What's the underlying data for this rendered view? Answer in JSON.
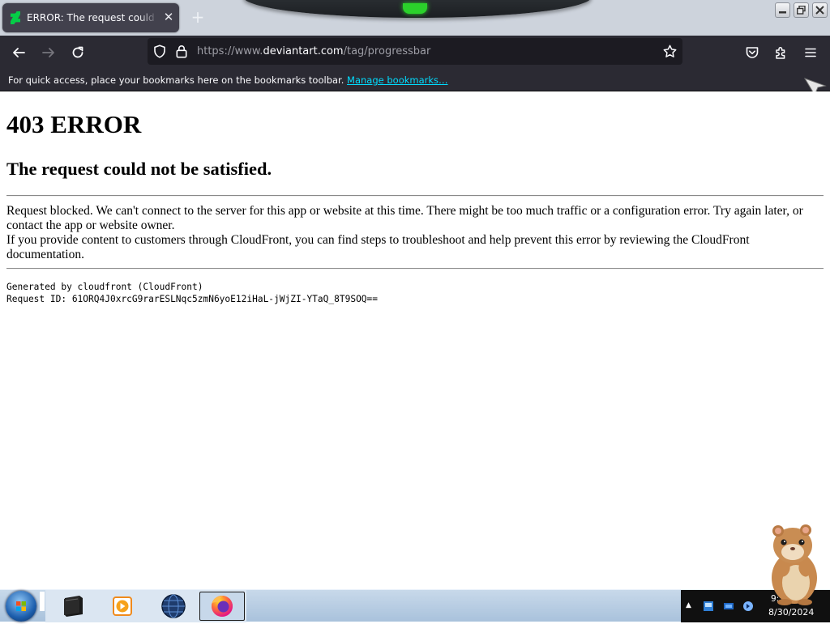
{
  "browser": {
    "tab": {
      "title": "ERROR: The request could not be satisfied",
      "close_glyph": "✕"
    },
    "new_tab_glyph": "+",
    "url": {
      "scheme": "https://www.",
      "domain": "deviantart.com",
      "path": "/tag/progressbar"
    },
    "bookmarks_toolbar": {
      "message": "For quick access, place your bookmarks here on the bookmarks toolbar.",
      "link": "Manage bookmarks…"
    },
    "icons": {
      "back": "arrow-left-icon",
      "forward": "arrow-right-icon",
      "reload": "reload-icon",
      "tracking": "shield-icon",
      "lock": "lock-icon",
      "bookmark": "star-icon",
      "pocket": "pocket-icon",
      "extensions": "puzzle-icon",
      "menu": "hamburger-menu-icon"
    }
  },
  "page": {
    "heading": "403 ERROR",
    "subheading": "The request could not be satisfied.",
    "paragraph_1": "Request blocked. We can't connect to the server for this app or website at this time. There might be too much traffic or a configuration error. Try again later, or contact the app or website owner.",
    "paragraph_2": "If you provide content to customers through CloudFront, you can find steps to troubleshoot and help prevent this error by reviewing the CloudFront documentation.",
    "generated_by": "Generated by cloudfront (CloudFront)",
    "request_id": "Request ID: 61ORQ4J0xrcG9rarESLNqc5zmN6yoE12iHaL-jWjZI-YTaQ_8T9SOQ=="
  },
  "taskbar": {
    "apps": [
      "terminal-app",
      "media-player-app",
      "globe-browser-app",
      "firefox-app"
    ],
    "active_app": "firefox-app",
    "tray": {
      "overflow_glyph": "▲",
      "time": "9:",
      "date": "8/30/2024"
    }
  },
  "colors": {
    "chrome_dark": "#2b2a33",
    "urlbar": "#1c1b22",
    "link_cyan": "#00ddff",
    "titlebar": "#cdd3dc",
    "taskbar": "#a9c2dc"
  }
}
